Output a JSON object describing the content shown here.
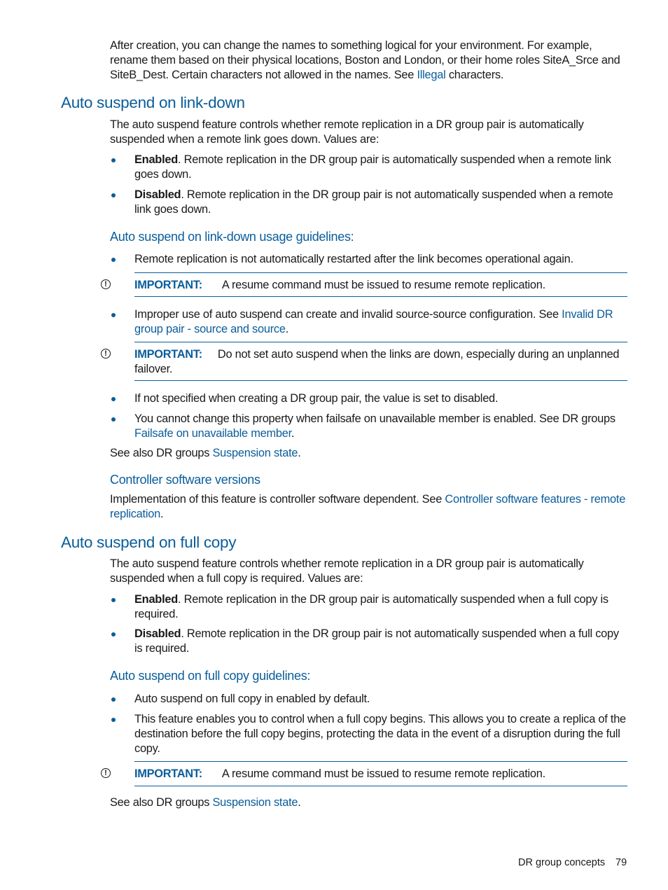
{
  "intro": {
    "text_before_link": "After creation, you can change the names to something logical for your environment. For example, rename them based on their physical locations, Boston and London, or their home roles SiteA_Srce and SiteB_Dest. Certain characters not allowed in the names. See ",
    "link": "Illegal",
    "text_after_link": " characters."
  },
  "section1": {
    "heading": "Auto suspend on link-down",
    "paragraph": "The auto suspend feature controls whether remote replication in a DR group pair is automatically suspended when a remote link goes down. Values are:",
    "values": [
      {
        "term": "Enabled",
        "text": ". Remote replication in the DR group pair is automatically suspended when a remote link goes down."
      },
      {
        "term": "Disabled",
        "text": ". Remote replication in the DR group pair is not automatically suspended when a remote link goes down."
      }
    ],
    "guidelines_heading": "Auto suspend on link-down usage guidelines:",
    "guideline_1": "Remote replication is not automatically restarted after the link becomes operational again.",
    "important_1": {
      "label": "IMPORTANT:",
      "text": "A resume command must be issued to resume remote replication."
    },
    "guideline_2": {
      "text": "Improper use of auto suspend can create and invalid source-source configuration. See ",
      "link": "Invalid DR group pair - source and source",
      "after": "."
    },
    "important_2": {
      "label": "IMPORTANT:",
      "text": "Do not set auto suspend when the links are down, especially during an unplanned failover."
    },
    "guideline_3": "If not specified when creating a DR group pair, the value is set to disabled.",
    "guideline_4": {
      "text": "You cannot change this property when failsafe on unavailable member is enabled. See DR groups ",
      "link": "Failsafe on unavailable member",
      "after": "."
    },
    "see_also": {
      "text": "See also DR groups ",
      "link": "Suspension state",
      "after": "."
    },
    "controller_heading": "Controller software versions",
    "controller_text": {
      "text": "Implementation of this feature is controller software dependent. See ",
      "link": "Controller software features - remote replication",
      "after": "."
    }
  },
  "section2": {
    "heading": "Auto suspend on full copy",
    "paragraph": "The auto suspend feature controls whether remote replication in a DR group pair is automatically suspended when a full copy is required. Values are:",
    "values": [
      {
        "term": "Enabled",
        "text": ". Remote replication in the DR group pair is automatically suspended when a full copy is required."
      },
      {
        "term": "Disabled",
        "text": ". Remote replication in the DR group pair is not automatically suspended when a full copy is required."
      }
    ],
    "guidelines_heading": "Auto suspend on full copy guidelines:",
    "guideline_1": "Auto suspend on full copy in enabled by default.",
    "guideline_2": "This feature enables you to control when a full copy begins. This allows you to create a replica of the destination before the full copy begins, protecting the data in the event of a disruption during the full copy.",
    "important_1": {
      "label": "IMPORTANT:",
      "text": "A resume command must be issued to resume remote replication."
    },
    "see_also": {
      "text": "See also DR groups ",
      "link": "Suspension state",
      "after": "."
    }
  },
  "footer": {
    "section_title": "DR group concepts",
    "page_number": "79"
  },
  "icons": {
    "important": "!"
  }
}
